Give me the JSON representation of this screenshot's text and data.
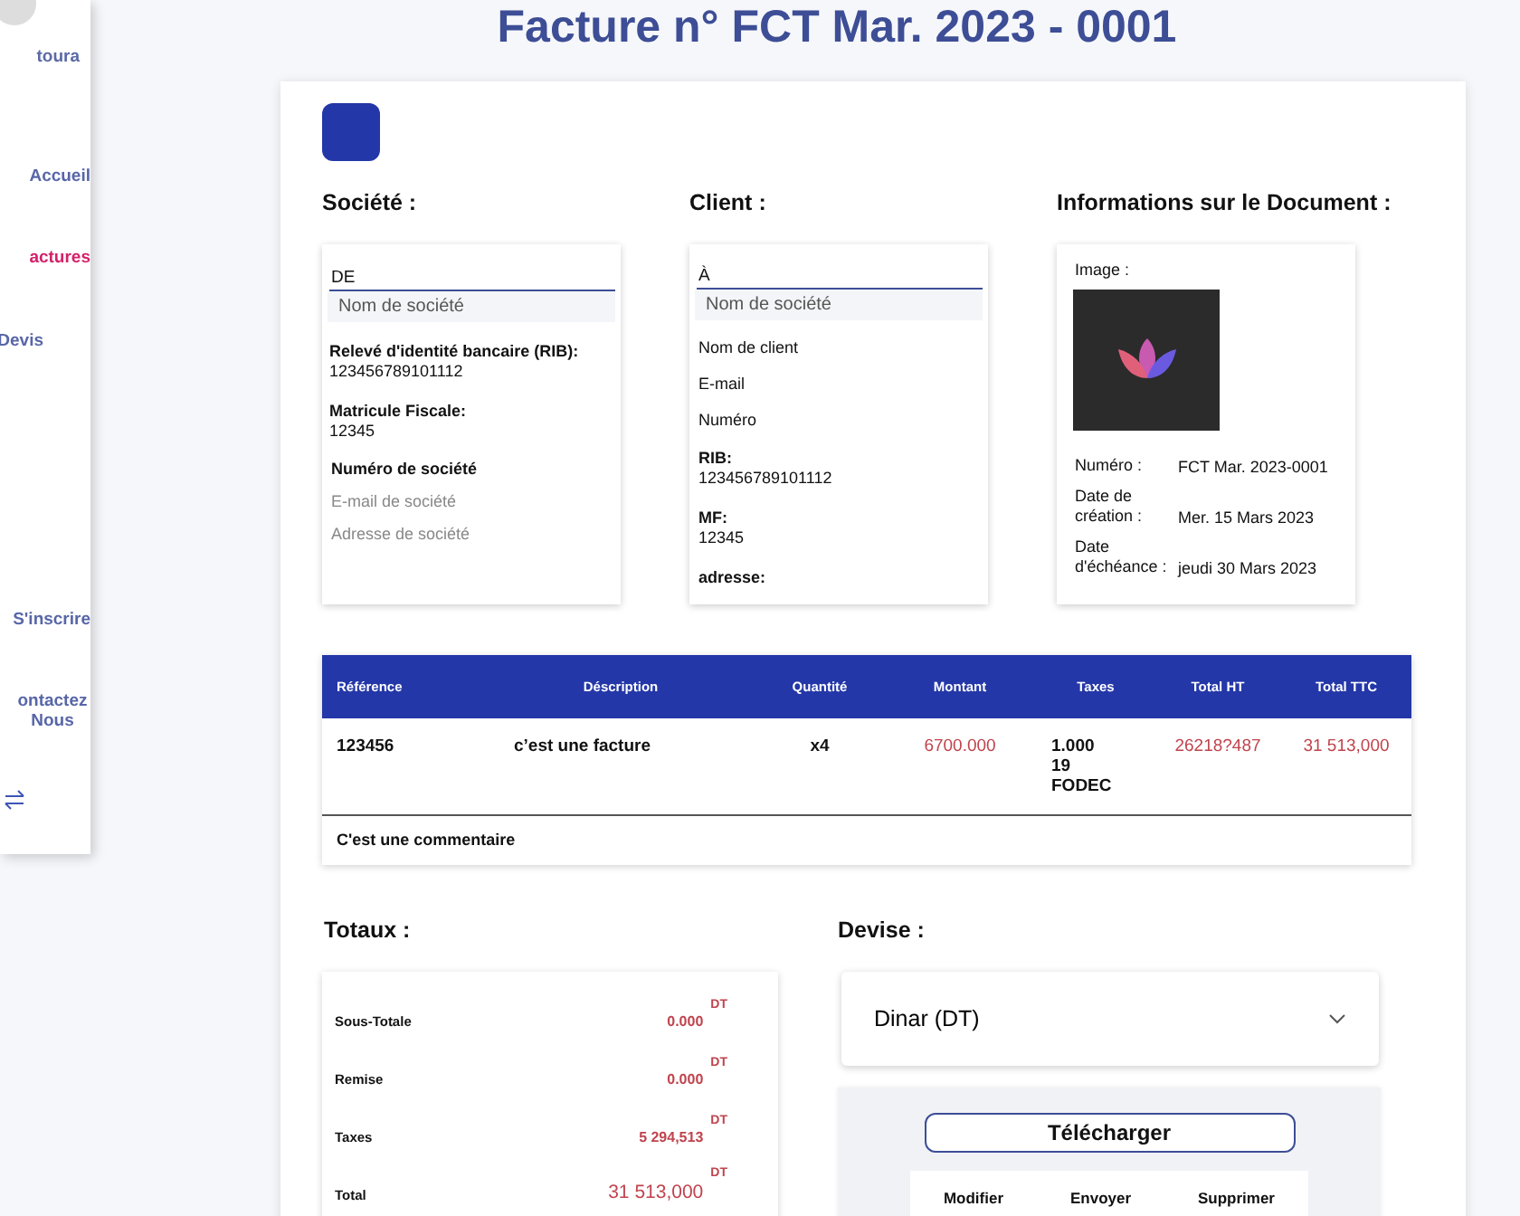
{
  "sidebar": {
    "brand": "toura",
    "items": [
      {
        "label": "Accueil",
        "selected": false
      },
      {
        "label": "actures",
        "selected": true
      },
      {
        "label": "Devis",
        "selected": false
      },
      {
        "label": "S'inscrire",
        "selected": false
      },
      {
        "label": "ontactez Nous",
        "selected": false
      }
    ]
  },
  "title": "Facture n° FCT Mar. 2023 - 0001",
  "company": {
    "heading": "Société :",
    "prefix": "DE",
    "name_placeholder": "Nom  de société",
    "fields": [
      {
        "label": "Relevé d'identité bancaire (RIB):",
        "value": "123456789101112"
      },
      {
        "label": "Matricule Fiscale:",
        "value": "12345"
      }
    ],
    "lines": [
      {
        "text": "Numéro de société",
        "kind": "value"
      },
      {
        "text": "E-mail de société",
        "kind": "placeholder"
      },
      {
        "text": "Adresse de société",
        "kind": "placeholder"
      }
    ]
  },
  "client": {
    "heading": "Client :",
    "prefix": "À",
    "name_placeholder": "Nom  de société",
    "lines": [
      {
        "text": "Nom de  client"
      },
      {
        "text": "E-mail"
      },
      {
        "text": "Numéro"
      }
    ],
    "fields": [
      {
        "label": "RIB:",
        "value": "123456789101112"
      },
      {
        "label": "MF:",
        "value": "12345"
      },
      {
        "label": "adresse:"
      }
    ]
  },
  "document": {
    "heading": "Informations sur le Document :",
    "image_label": "Image :",
    "rows": [
      {
        "label": "Numéro :",
        "value": "FCT Mar. 2023-0001"
      },
      {
        "label": "Date de création :",
        "value": "Mer. 15 Mars 2023"
      },
      {
        "label": "Date d'échéance :",
        "value": "jeudi 30 Mars 2023"
      }
    ]
  },
  "table": {
    "columns": [
      "Référence",
      "Déscription",
      "Quantité",
      "Montant",
      "Taxes",
      "Total HT",
      "Total TTC"
    ],
    "rows": [
      [
        "123456",
        "c’est une facture",
        "x4",
        "6700.000",
        "1.000\n19\nFODEC",
        "26218?487",
        "31 513,000"
      ]
    ],
    "comment": "C'est une commentaire"
  },
  "totals": {
    "heading": "Totaux :",
    "rows": [
      {
        "label": "Sous-Totale",
        "value": "0.000",
        "unit": "DT"
      },
      {
        "label": "Remise",
        "value": "0.000",
        "unit": "DT"
      },
      {
        "label": "Taxes",
        "value": "5 294,513",
        "unit": "DT"
      },
      {
        "label": "Total",
        "value": "31 513,000",
        "unit": "DT"
      }
    ]
  },
  "currency": {
    "heading": "Devise :",
    "value": "Dinar (DT)"
  },
  "actions": {
    "download": "Télécharger",
    "buttons": [
      "Modifier",
      "Envoyer",
      "Supprimer"
    ]
  }
}
